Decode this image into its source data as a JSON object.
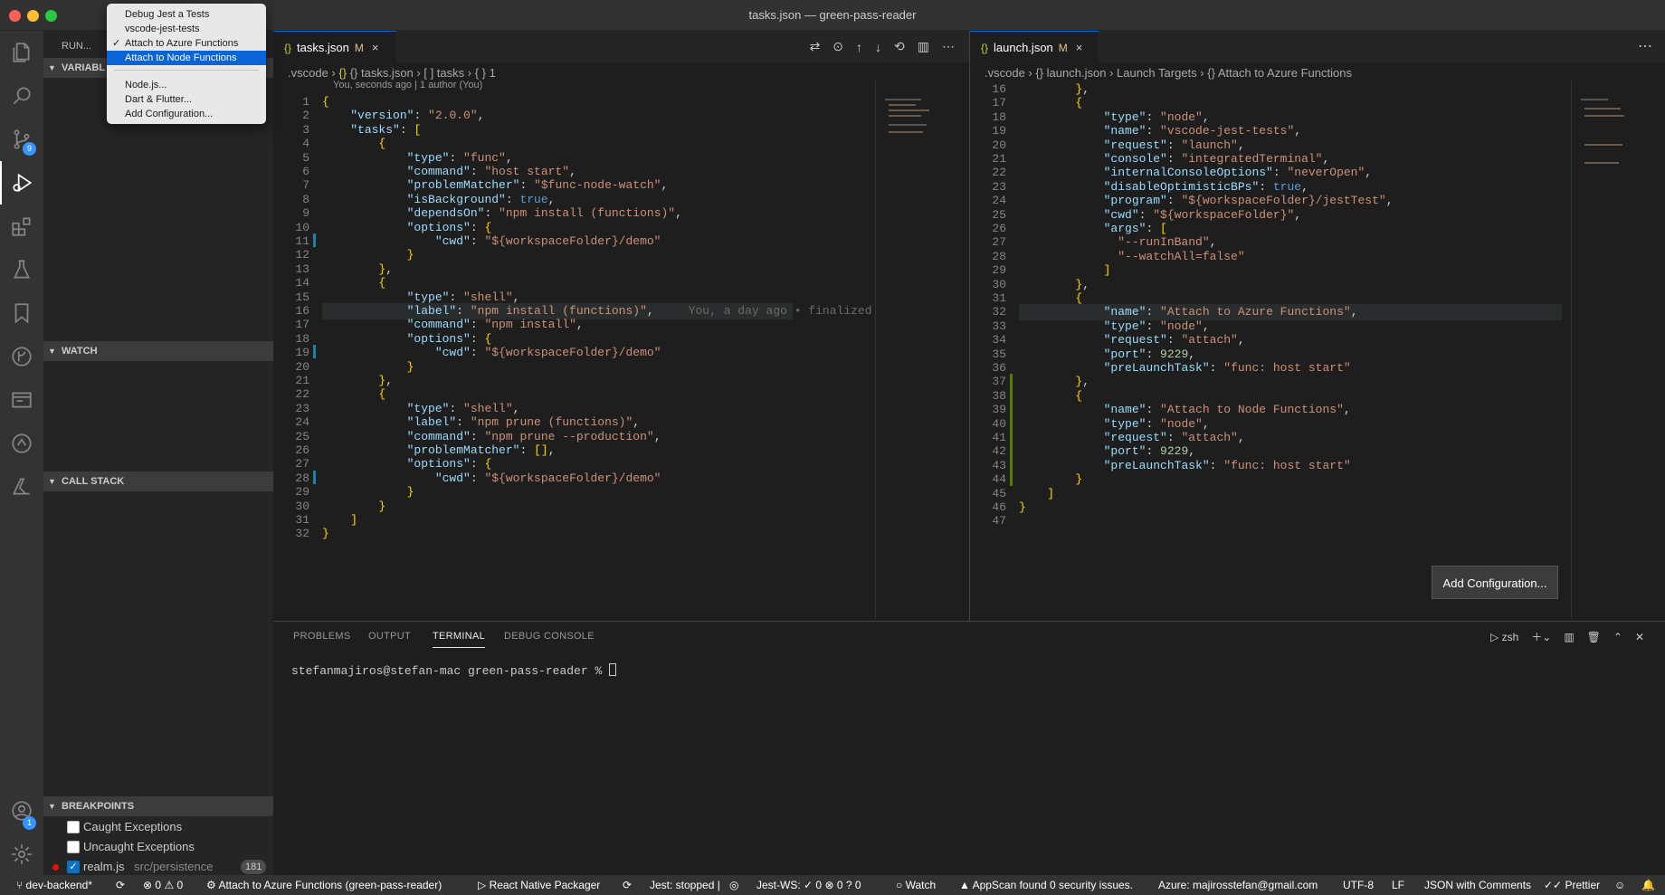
{
  "window": {
    "title": "tasks.json — green-pass-reader"
  },
  "activity": {
    "scm_badge": "9",
    "account_badge": "1"
  },
  "sidebar": {
    "run_label": "RUN...",
    "variables_header": "VARIABL",
    "watch_header": "WATCH",
    "callstack_header": "CALL STACK",
    "breakpoints_header": "BREAKPOINTS",
    "breakpoints": [
      {
        "label": "Caught Exceptions",
        "checked": false
      },
      {
        "label": "Uncaught Exceptions",
        "checked": false
      },
      {
        "label": "realm.js",
        "path": "src/persistence",
        "count": "181",
        "checked": true
      }
    ]
  },
  "menu": {
    "items": [
      "Debug Jest a Tests",
      "vscode-jest-tests",
      "Attach to Azure Functions",
      "Attach to Node Functions",
      "Node.js...",
      "Dart & Flutter...",
      "Add Configuration..."
    ],
    "checked_item": "Attach to Azure Functions",
    "selected_item": "Attach to Node Functions"
  },
  "left_editor": {
    "tab": {
      "icon": "{}",
      "name": "tasks.json",
      "modified": "M",
      "close": "×"
    },
    "breadcrumb": [
      ".vscode",
      "{} tasks.json",
      "[ ] tasks",
      "{ } 1"
    ],
    "blame": "You, seconds ago | 1 author (You)",
    "inline_blame": "You, a day ago • finalized azu",
    "first_line": 1,
    "lines": [
      "{",
      "    \"version\": \"2.0.0\",",
      "    \"tasks\": [",
      "        {",
      "            \"type\": \"func\",",
      "            \"command\": \"host start\",",
      "            \"problemMatcher\": \"$func-node-watch\",",
      "            \"isBackground\": true,",
      "            \"dependsOn\": \"npm install (functions)\",",
      "            \"options\": {",
      "                \"cwd\": \"${workspaceFolder}/demo\"",
      "            }",
      "        },",
      "        {",
      "            \"type\": \"shell\",",
      "            \"label\": \"npm install (functions)\",",
      "            \"command\": \"npm install\",",
      "            \"options\": {",
      "                \"cwd\": \"${workspaceFolder}/demo\"",
      "            }",
      "        },",
      "        {",
      "            \"type\": \"shell\",",
      "            \"label\": \"npm prune (functions)\",",
      "            \"command\": \"npm prune --production\",",
      "            \"problemMatcher\": [],",
      "            \"options\": {",
      "                \"cwd\": \"${workspaceFolder}/demo\"",
      "            }",
      "        }",
      "    ]",
      "}"
    ]
  },
  "right_editor": {
    "tab": {
      "icon": "{}",
      "name": "launch.json",
      "modified": "M",
      "close": "×"
    },
    "breadcrumb": [
      ".vscode",
      "{} launch.json",
      "Launch Targets",
      "{} Attach to Azure Functions"
    ],
    "first_line": 16,
    "lines": [
      "        },",
      "        {",
      "            \"type\": \"node\",",
      "            \"name\": \"vscode-jest-tests\",",
      "            \"request\": \"launch\",",
      "            \"console\": \"integratedTerminal\",",
      "            \"internalConsoleOptions\": \"neverOpen\",",
      "            \"disableOptimisticBPs\": true,",
      "            \"program\": \"${workspaceFolder}/jestTest\",",
      "            \"cwd\": \"${workspaceFolder}\",",
      "            \"args\": [",
      "              \"--runInBand\",",
      "              \"--watchAll=false\"",
      "            ]",
      "        },",
      "        {",
      "            \"name\": \"Attach to Azure Functions\",",
      "            \"type\": \"node\",",
      "            \"request\": \"attach\",",
      "            \"port\": 9229,",
      "            \"preLaunchTask\": \"func: host start\"",
      "        },",
      "        {",
      "            \"name\": \"Attach to Node Functions\",",
      "            \"type\": \"node\",",
      "            \"request\": \"attach\",",
      "            \"port\": 9229,",
      "            \"preLaunchTask\": \"func: host start\"",
      "        }",
      "    ]",
      "}",
      ""
    ],
    "add_configuration_button": "Add Configuration..."
  },
  "panel": {
    "tabs": [
      "PROBLEMS",
      "OUTPUT",
      "TERMINAL",
      "DEBUG CONSOLE"
    ],
    "active_tab": "TERMINAL",
    "shell": "zsh",
    "prompt": "stefanmajiros@stefan-mac green-pass-reader % "
  },
  "status": {
    "branch": "dev-backend*",
    "errors": "0",
    "warnings": "0",
    "debug_target": "Attach to Azure Functions (green-pass-reader)",
    "packager": "React Native Packager",
    "jest": "Jest: stopped |",
    "jest_ws": "Jest-WS: ",
    "jest_ws_pass": "0",
    "jest_ws_fail": "0",
    "jest_ws_unknown": "0",
    "watch": "Watch",
    "appscan": "AppScan found 0 security issues.",
    "azure": "Azure: majirosstefan@gmail.com",
    "encoding": "UTF-8",
    "eol": "LF",
    "language": "JSON with Comments",
    "prettier": "Prettier"
  },
  "colors": {
    "accent": "#0a64d5",
    "statusbar": "#333333",
    "string": "#ce9178",
    "key": "#9cdcfe",
    "number": "#b5cea8",
    "keyword": "#569cd6"
  }
}
